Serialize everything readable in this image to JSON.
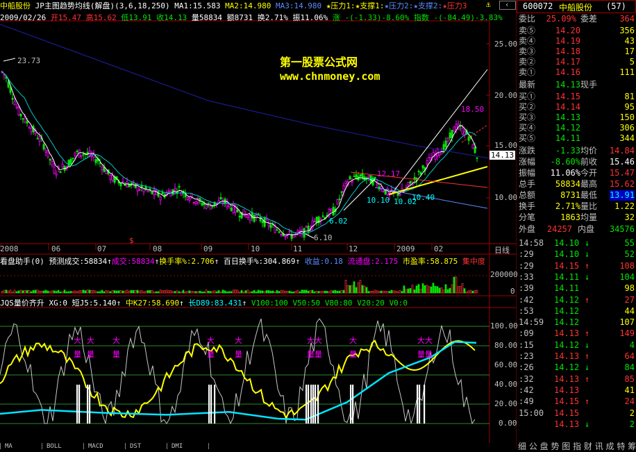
{
  "header": {
    "stock_short": "中船股份",
    "indicator_name": "JP主图趋势均线(解盘)",
    "indicator_params": "(3,6,18,250)",
    "ma1": "MA1:15.583",
    "ma2": "MA2:14.980",
    "ma3": "MA3:14.980",
    "pressure1": "★压力1:",
    "support1": "★支撑1:",
    "pressure2": "★压力2:",
    "support2": "★支撑2:",
    "pressure3": "★压力3",
    "row2_date": "2009/02/26",
    "row2_open": "开15.47",
    "row2_high": "高15.62",
    "row2_low": "低13.91",
    "row2_close": "收14.13",
    "row2_vol": "量58834",
    "row2_amount": "额8731",
    "row2_turnover": "换2.71%",
    "row2_amplitude": "振11.06%",
    "row2_change": "涨 -(-1.33)-8.60%",
    "row2_index": "指数 -(-84.49)-3.83%"
  },
  "watermark": {
    "title": "第一股票公式网",
    "url": "www.chnmoney.com"
  },
  "price_axis": [
    "25.00",
    "20.00",
    "15.00",
    "10.00"
  ],
  "current_price_tag": "14.13",
  "annotations": {
    "high_label": "23.73",
    "peak_label": "18.50",
    "low_label": "6.10",
    "low2_label": "6.02",
    "mid_label": "12.17",
    "l1": "10.10",
    "l2": "10.02",
    "l3": "10.40"
  },
  "time_axis": [
    "2008",
    "06",
    "07",
    "08",
    "09",
    "10",
    "11",
    "12",
    "2009",
    "02"
  ],
  "period_label": "日线",
  "vol_panel": {
    "title": "看盘助手(0)",
    "pred_vol": "预测成交:58834",
    "deal": "成交:58834",
    "turnover": "换手率%:2.706",
    "hundred_day": "百日换手%:304.869",
    "return": "收益:0.18",
    "float_cap": "流通盘:2.175",
    "pe": "市盈率:58.875",
    "concentrate": "集中度",
    "axis_200000": "200000",
    "axis_0": "0"
  },
  "lower_panel": {
    "title": "JQS量价齐升",
    "xg": "XG:0",
    "short": "短J5:5.140",
    "mid": "中K27:58.690",
    "long": "长D89:83.431",
    "v100": "V100:100",
    "v50": "V50:50",
    "v80": "V80:80",
    "v20": "V20:20",
    "v0": "V0:0",
    "axis": [
      "100.00",
      "80.00",
      "60.00",
      "40.00",
      "20.00",
      "0.00"
    ],
    "big1": "大",
    "big2": "量"
  },
  "quote": {
    "code": "600072",
    "name": "中船股份",
    "rank": "(57)",
    "weibi_label": "委比",
    "weibi": "25.09%",
    "weicha_label": "委差",
    "weicha": "364",
    "sell": [
      {
        "label": "卖⑤",
        "price": "14.20",
        "vol": "356"
      },
      {
        "label": "卖④",
        "price": "14.19",
        "vol": "43"
      },
      {
        "label": "卖③",
        "price": "14.18",
        "vol": "17"
      },
      {
        "label": "卖②",
        "price": "14.17",
        "vol": "5"
      },
      {
        "label": "卖①",
        "price": "14.16",
        "vol": "111"
      }
    ],
    "latest_label": "最新",
    "latest": "14.13",
    "spot_label": "现手",
    "buy": [
      {
        "label": "买①",
        "price": "14.15",
        "vol": "81"
      },
      {
        "label": "买②",
        "price": "14.14",
        "vol": "95"
      },
      {
        "label": "买③",
        "price": "14.13",
        "vol": "150"
      },
      {
        "label": "买④",
        "price": "14.12",
        "vol": "306"
      },
      {
        "label": "买⑤",
        "price": "14.11",
        "vol": "344"
      }
    ],
    "stats": [
      {
        "l1": "涨跌",
        "v1": "-1.33",
        "l2": "均价",
        "v2": "14.84"
      },
      {
        "l1": "涨幅",
        "v1": "-8.60%",
        "l2": "前收",
        "v2": "15.46"
      },
      {
        "l1": "振幅",
        "v1": "11.06%",
        "l2": "今开",
        "v2": "15.47"
      },
      {
        "l1": "总手",
        "v1": "58834",
        "l2": "最高",
        "v2": "15.62"
      },
      {
        "l1": "总额",
        "v1": "8731",
        "l2": "最低",
        "v2": "13.91"
      },
      {
        "l1": "换手",
        "v1": "2.71%",
        "l2": "量比",
        "v2": "1.22"
      },
      {
        "l1": "分笔",
        "v1": "1863",
        "l2": "均量",
        "v2": "32"
      }
    ],
    "outer_label": "外盘",
    "outer": "24257",
    "inner_label": "内盘",
    "inner": "34576",
    "ticks": [
      {
        "t": "14:58",
        "p": "14.10",
        "a": "↓",
        "q": "55"
      },
      {
        "t": ":29",
        "p": "14.10",
        "a": "↓",
        "q": "52"
      },
      {
        "t": ":29",
        "p": "14.15",
        "a": "↑",
        "q": "108"
      },
      {
        "t": ":33",
        "p": "14.11",
        "a": "↓",
        "q": "104"
      },
      {
        "t": ":39",
        "p": "14.11",
        "a": "",
        "q": "98"
      },
      {
        "t": ":42",
        "p": "14.12",
        "a": "↑",
        "q": "27"
      },
      {
        "t": ":53",
        "p": "14.12",
        "a": "",
        "q": "44"
      },
      {
        "t": "14:59",
        "p": "14.12",
        "a": "",
        "q": "107"
      },
      {
        "t": ":09",
        "p": "14.13",
        "a": "↑",
        "q": "149"
      },
      {
        "t": ":15",
        "p": "14.12",
        "a": "↓",
        "q": "4"
      },
      {
        "t": ":23",
        "p": "14.13",
        "a": "↑",
        "q": "64"
      },
      {
        "t": ":26",
        "p": "14.12",
        "a": "↓",
        "q": "84"
      },
      {
        "t": ":32",
        "p": "14.13",
        "a": "↑",
        "q": "85"
      },
      {
        "t": ":42",
        "p": "14.13",
        "a": "",
        "q": "41"
      },
      {
        "t": ":49",
        "p": "14.15",
        "a": "↑",
        "q": "24"
      },
      {
        "t": "15:00",
        "p": "14.15",
        "a": "",
        "q": "2"
      },
      {
        "t": "",
        "p": "14.13",
        "a": "↓",
        "q": "2"
      }
    ],
    "bottom_text": "细 公 盘 势 图 指 财 讯 成 特 筹"
  },
  "tabs": [
    "MA",
    "BOLL",
    "MACD",
    "DST",
    "DMI"
  ],
  "colors": {
    "up": "#ff3232",
    "down": "#00e600",
    "bg": "#000000",
    "axis": "#a00000"
  }
}
